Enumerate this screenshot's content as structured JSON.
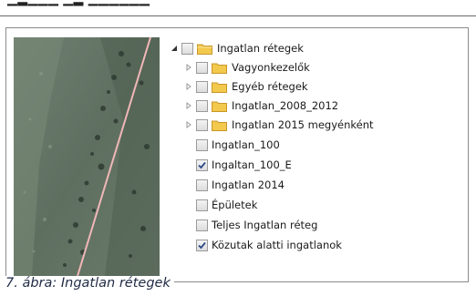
{
  "caption": "7. ábra: Ingatlan rétegek",
  "tree": {
    "root": {
      "label": "Ingatlan rétegek",
      "expanded": true,
      "checked": false,
      "icon": "folder-icon"
    },
    "folders": [
      {
        "label": "Vagyonkezelők",
        "checked": false,
        "expanded": false
      },
      {
        "label": "Egyéb rétegek",
        "checked": false,
        "expanded": false
      },
      {
        "label": "Ingatlan_2008_2012",
        "checked": false,
        "expanded": false
      },
      {
        "label": "Ingatlan 2015 megyénként",
        "checked": false,
        "expanded": false
      }
    ],
    "layers": [
      {
        "label": "Ingatlan_100",
        "checked": false
      },
      {
        "label": "Ingaltan_100_E",
        "checked": true
      },
      {
        "label": "Ingatlan 2014",
        "checked": false
      },
      {
        "label": "Épületek",
        "checked": false
      },
      {
        "label": "Teljes Ingatlan réteg",
        "checked": false
      },
      {
        "label": "Közutak alatti ingatlanok",
        "checked": true
      }
    ]
  },
  "colors": {
    "folder": "#f2c94c",
    "folder_dark": "#c9962a",
    "check": "#2b4a8a",
    "map_line": "#f0b7b7",
    "caption": "#1f2a44"
  }
}
